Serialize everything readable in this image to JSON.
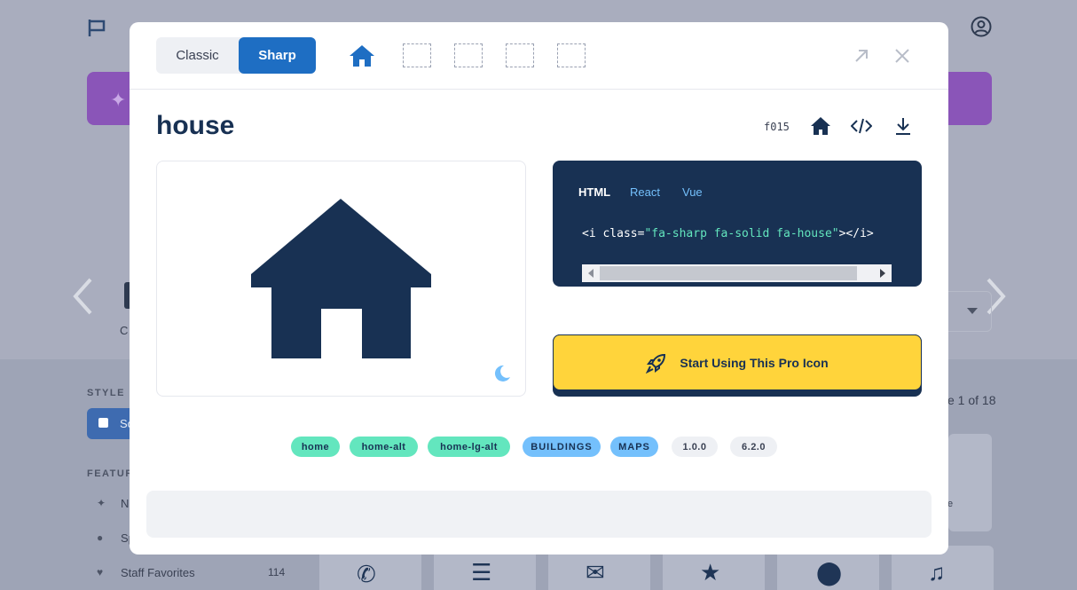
{
  "background": {
    "staff_favorites": "Staff Favorites",
    "staff_count": "114",
    "style_label": "STYLE",
    "features_label": "FEATUR",
    "pagination": "e 1 of 18",
    "feature_partial_new": "N",
    "feature_partial_sp": "Sp",
    "feature_partial_style": "So",
    "partial_left_label": "C",
    "partial_right_label": "e"
  },
  "modal": {
    "toggle": {
      "classic": "Classic",
      "sharp": "Sharp",
      "active": "Sharp"
    },
    "style_icons": [
      "house-icon"
    ],
    "icon_name": "house",
    "unicode": "f015",
    "code": {
      "tabs": [
        "HTML",
        "React",
        "Vue"
      ],
      "active_tab": "HTML",
      "prefix": "<i class=",
      "class_string": "\"fa-sharp fa-solid fa-house\"",
      "suffix": "></i>"
    },
    "cta_label": "Start Using This Pro Icon",
    "tags": {
      "aliases": [
        "home",
        "home-alt",
        "home-lg-alt"
      ],
      "categories": [
        "BUILDINGS",
        "MAPS"
      ],
      "versions": [
        "1.0.0",
        "6.2.0"
      ]
    },
    "colors": {
      "primary": "#183153",
      "toggle_active": "#1e6ec3",
      "cta": "#ffd43b",
      "alias_tag": "#63e6be",
      "category_tag": "#74c0fc",
      "code_string": "#63e6be",
      "code_tab_link": "#74c0fc"
    }
  }
}
